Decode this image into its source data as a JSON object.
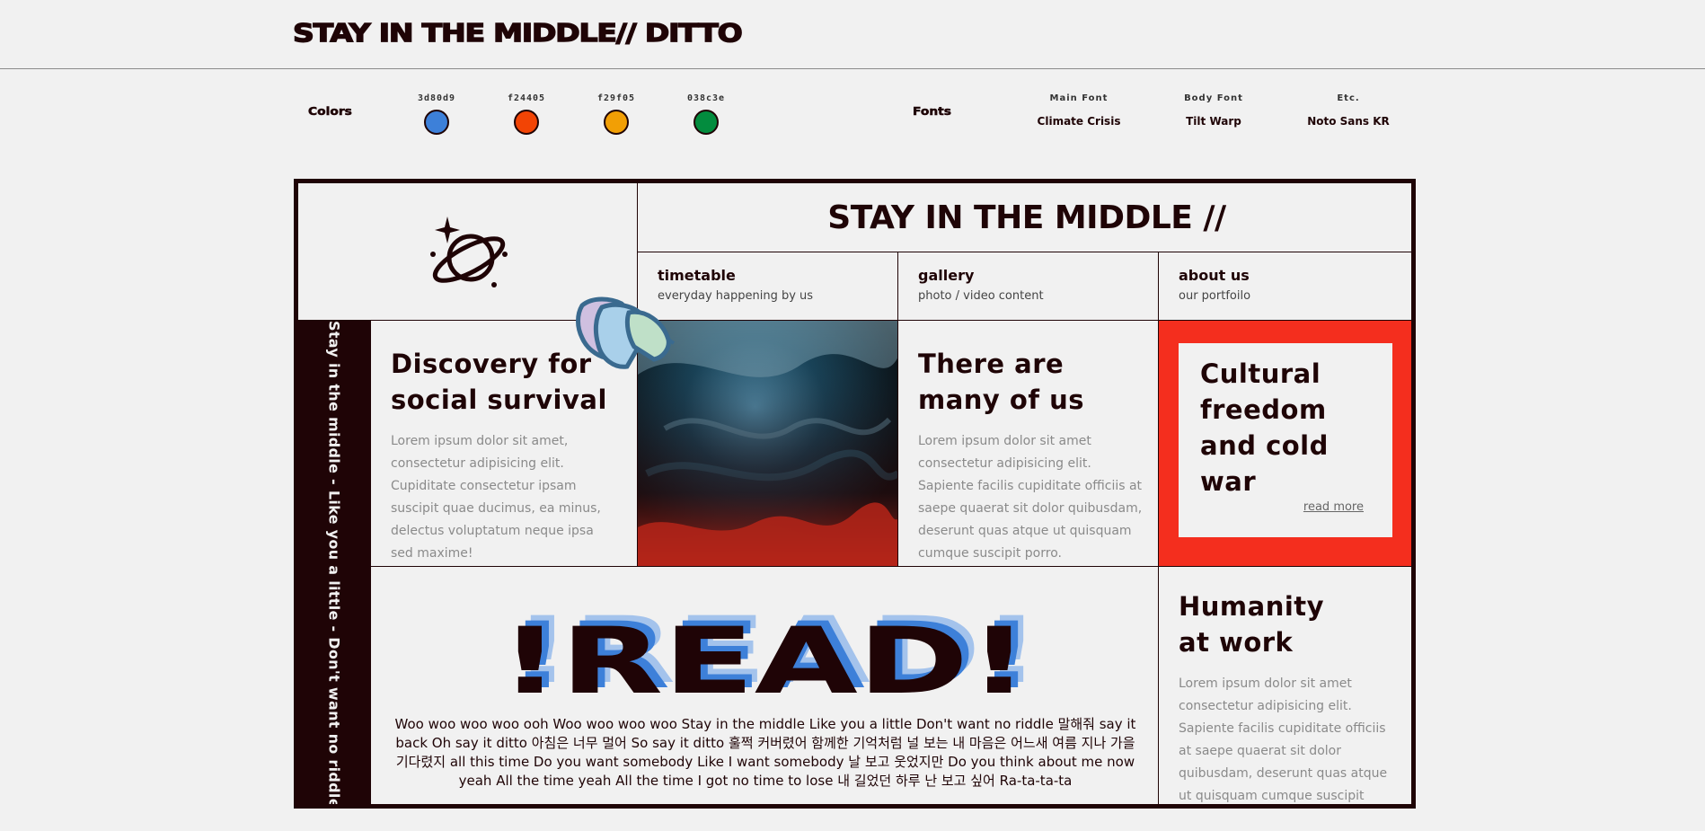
{
  "header": {
    "title": "STAY IN THE MIDDLE// DITTO"
  },
  "style_guide": {
    "colors_label": "Colors",
    "colors": [
      {
        "code": "3d80d9",
        "hex": "#3d80d9"
      },
      {
        "code": "f24405",
        "hex": "#f24405"
      },
      {
        "code": "f29f05",
        "hex": "#f29f05"
      },
      {
        "code": "038c3e",
        "hex": "#038c3e"
      }
    ],
    "fonts_label": "Fonts",
    "fonts": [
      {
        "caption": "Main Font",
        "value": "Climate Crisis"
      },
      {
        "caption": "Body Font",
        "value": "Tilt Warp"
      },
      {
        "caption": "Etc.",
        "value": "Noto Sans KR"
      }
    ]
  },
  "poster": {
    "logo_icon": "planet-icon",
    "banner": "STAY IN THE MIDDLE //",
    "nav": [
      {
        "title": "timetable",
        "subtitle": "everyday happening by us"
      },
      {
        "title": "gallery",
        "subtitle": "photo / video content"
      },
      {
        "title": "about us",
        "subtitle": "our portfoilo"
      }
    ],
    "vertical_text": "Stay in the middle - Like you a little - Don't want no riddle",
    "discovery": {
      "heading_1": "Discovery for",
      "heading_2": "social survival",
      "body": "Lorem ipsum dolor sit amet, consectetur adipisicing elit. Cupiditate consectetur ipsam suscipit quae ducimus, ea minus, delectus voluptatum neque ipsa sed maxime!"
    },
    "many": {
      "heading_1": "There are",
      "heading_2": "many of us",
      "body": "Lorem ipsum dolor sit amet consectetur adipisicing elit. Sapiente facilis cupiditate officiis at saepe quaerat sit dolor quibusdam, deserunt quas atque ut quisquam cumque suscipit porro."
    },
    "cultural": {
      "line_1": "Cultural",
      "line_2": "freedom",
      "line_3": "and cold",
      "line_4": "war",
      "link": "read more"
    },
    "read": {
      "headline": "!READ!",
      "lyrics": "Woo woo woo woo ooh Woo woo woo woo Stay in the middle Like you a little Don't want no riddle 말해줘 say it back Oh say it ditto 아침은 너무 멀어 So say it ditto 훌쩍 커버렸어 함께한 기억처럼 널 보는 내 마음은 어느새 여름 지나 가을 기다렸지 all this time Do you want somebody Like I want somebody 날 보고 웃었지만 Do you think about me now yeah All the time yeah All the time I got no time to lose 내 길었던 하루 난 보고 싶어 Ra-ta-ta-ta"
    },
    "humanity": {
      "heading_1": "Humanity",
      "heading_2": "at work",
      "body": "Lorem ipsum dolor sit amet consectetur adipisicing elit. Sapiente facilis cupiditate officiis at saepe quaerat sit dolor quibusdam, deserunt quas atque ut quisquam cumque suscipit porro."
    },
    "accent_red": "#f42e1e",
    "ink": "#1f0406"
  }
}
